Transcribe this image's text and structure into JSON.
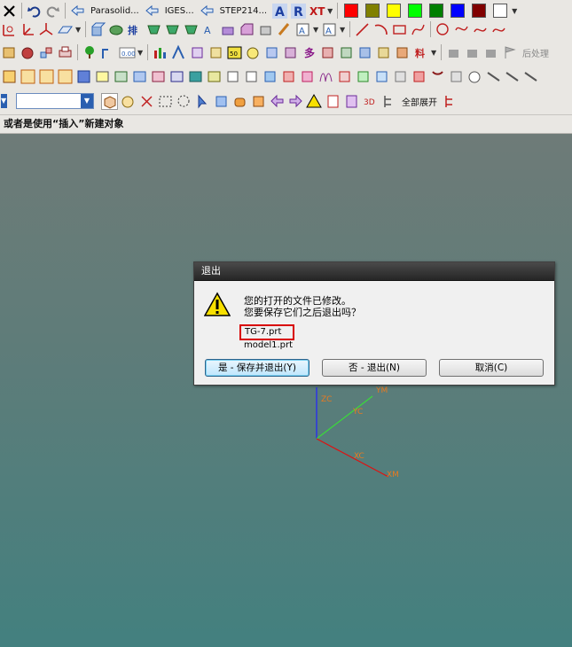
{
  "toolbar_top": {
    "parasolid_label": "Parasolid...",
    "iges_label": "IGES...",
    "step_label": "STEP214...",
    "colors": [
      "#ff0000",
      "#808000",
      "#ffff00",
      "#00ff00",
      "#008000",
      "#0000ff",
      "#800000",
      "#ffffff"
    ]
  },
  "toolbar_r2": {
    "postprocess_label": "后处理"
  },
  "toolbar_r4": {
    "expand_all_label": "全部展开",
    "combo_value": ""
  },
  "status": {
    "prompt": "或者是使用“插入”新建对象"
  },
  "dialog": {
    "title": "退出",
    "message_line1": "您的打开的文件已修改。",
    "message_line2": "您要保存它们之后退出吗？",
    "files": [
      "TG-7.prt",
      "model1.prt"
    ],
    "buttons": {
      "save_exit": "是 - 保存并退出(Y)",
      "exit": "否 - 退出(N)",
      "cancel": "取消(C)"
    }
  },
  "axes": {
    "zc": "ZC",
    "yc": "YC",
    "xc": "XC",
    "ym": "YM",
    "xm": "XM"
  }
}
